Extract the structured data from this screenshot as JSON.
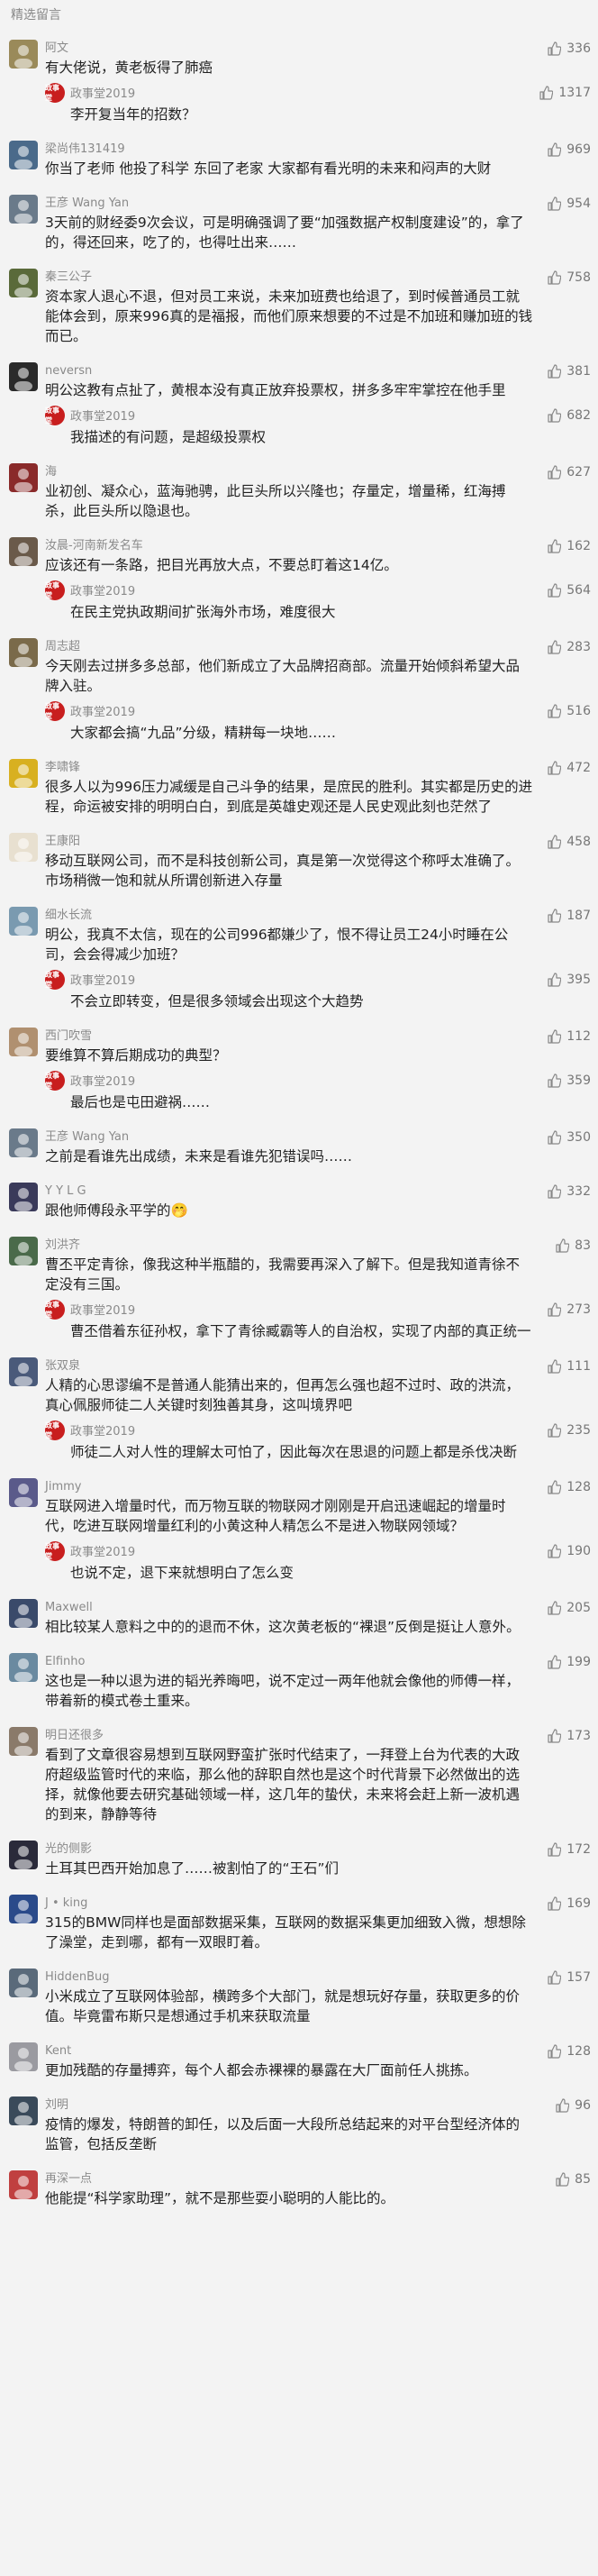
{
  "header": {
    "title": "精选留言"
  },
  "reply_author": "政事堂2019",
  "reply_logo_text": "政事堂",
  "comments": [
    {
      "name": "阿文",
      "likes": "336",
      "content": "有大佬说，黄老板得了肺癌",
      "reply": {
        "likes": "1317",
        "content": "李开复当年的招数？"
      },
      "avatar_color": "#9a8a5a"
    },
    {
      "name": "梁尚伟131419",
      "likes": "969",
      "content": "你当了老师 他投了科学 东回了老家 大家都有看光明的未来和闷声的大财",
      "avatar_color": "#4a6a8a"
    },
    {
      "name": "王彦 Wang Yan",
      "likes": "954",
      "content": "3天前的财经委9次会议，可是明确强调了要“加强数据产权制度建设”的，拿了的，得还回来，吃了的，也得吐出来……",
      "avatar_color": "#6a7a8a"
    },
    {
      "name": "秦三公子",
      "likes": "758",
      "content": "资本家人退心不退，但对员工来说，未来加班费也给退了，到时候普通员工就能体会到，原来996真的是福报，而他们原来想要的不过是不加班和赚加班的钱而已。",
      "avatar_color": "#5a6a3a"
    },
    {
      "name": "neversn",
      "likes": "381",
      "content": "明公这教有点扯了，黄根本没有真正放弃投票权，拼多多牢牢掌控在他手里",
      "reply": {
        "likes": "682",
        "content": "我描述的有问题，是超级投票权"
      },
      "avatar_color": "#2a2a2a"
    },
    {
      "name": "海",
      "likes": "627",
      "content": "业初创、凝众心，蓝海驰骋，此巨头所以兴隆也；存量定，增量稀，红海搏杀，此巨头所以隐退也。",
      "avatar_color": "#8a2a2a"
    },
    {
      "name": "汝晨-河南新发名车",
      "likes": "162",
      "content": "应该还有一条路，把目光再放大点，不要总盯着这14亿。",
      "reply": {
        "likes": "564",
        "content": "在民主党执政期间扩张海外市场，难度很大"
      },
      "avatar_color": "#6a5a4a"
    },
    {
      "name": "周志超",
      "likes": "283",
      "content": "今天刚去过拼多多总部，他们新成立了大品牌招商部。流量开始倾斜希望大品牌入驻。",
      "reply": {
        "likes": "516",
        "content": "大家都会搞“九品”分级，精耕每一块地……"
      },
      "avatar_color": "#7a6a4a"
    },
    {
      "name": "李啸锋",
      "likes": "472",
      "content": "很多人以为996压力减缓是自己斗争的结果，是庶民的胜利。其实都是历史的进程，命运被安排的明明白白，到底是英雄史观还是人民史观此刻也茫然了",
      "avatar_color": "#d8b020"
    },
    {
      "name": "王康阳",
      "likes": "458",
      "content": "移动互联网公司，而不是科技创新公司，真是第一次觉得这个称呼太准确了。市场稍微一饱和就从所谓创新进入存量",
      "avatar_color": "#e8e0d0"
    },
    {
      "name": "细水长流",
      "likes": "187",
      "content": "明公，我真不太信，现在的公司996都嫌少了，恨不得让员工24小时睡在公司，会会得减少加班？",
      "reply": {
        "likes": "395",
        "content": "不会立即转变，但是很多领域会出现这个大趋势"
      },
      "avatar_color": "#7a9ab0"
    },
    {
      "name": "西门吹雪",
      "likes": "112",
      "content": "要维算不算后期成功的典型？",
      "reply": {
        "likes": "359",
        "content": "最后也是屯田避祸……"
      },
      "avatar_color": "#b09070"
    },
    {
      "name": "王彦 Wang Yan",
      "likes": "350",
      "content": "之前是看谁先出成绩，未来是看谁先犯错误吗……",
      "avatar_color": "#6a7a8a"
    },
    {
      "name": "Y Y L G",
      "likes": "332",
      "content": "跟他师傅段永平学的🤭",
      "avatar_color": "#3a3a5a"
    },
    {
      "name": "刘洪齐",
      "likes": "83",
      "content": "曹丕平定青徐，像我这种半瓶醋的，我需要再深入了解下。但是我知道青徐不定没有三国。",
      "reply": {
        "likes": "273",
        "content": "曹丕借着东征孙权，拿下了青徐臧霸等人的自治权，实现了内部的真正统一"
      },
      "avatar_color": "#4a6a4a"
    },
    {
      "name": "张双泉",
      "likes": "111",
      "content": "人精的心思谬编不是普通人能猜出来的，但再怎么强也超不过时、政的洪流，真心佩服师徒二人关键时刻独善其身，这叫境界吧",
      "reply": {
        "likes": "235",
        "content": "师徒二人对人性的理解太可怕了，因此每次在思退的问题上都是杀伐决断"
      },
      "avatar_color": "#4a5a7a"
    },
    {
      "name": "Jimmy",
      "likes": "128",
      "content": "互联网进入增量时代，而万物互联的物联网才刚刚是开启迅速崛起的增量时代，吃进互联网增量红利的小黄这种人精怎么不是进入物联网领域？",
      "reply": {
        "likes": "190",
        "content": "也说不定，退下来就想明白了怎么变"
      },
      "avatar_color": "#5a5a8a"
    },
    {
      "name": "Maxwell",
      "likes": "205",
      "content": "相比较某人意料之中的的退而不休，这次黄老板的“裸退”反倒是挺让人意外。",
      "avatar_color": "#3a4a6a"
    },
    {
      "name": "Elfinho",
      "likes": "199",
      "content": "这也是一种以退为进的韬光养晦吧，说不定过一两年他就会像他的师傅一样，带着新的模式卷土重来。",
      "avatar_color": "#6a8aa0"
    },
    {
      "name": "明日还很多",
      "likes": "173",
      "content": "看到了文章很容易想到互联网野蛮扩张时代结束了，一拜登上台为代表的大政府超级监管时代的来临，那么他的辞职自然也是这个时代背景下必然做出的选择，就像他要去研究基础领域一样，这几年的蛰伏，未来将会赶上新一波机遇的到来，静静等待",
      "avatar_color": "#8a7a6a"
    },
    {
      "name": "光的侧影",
      "likes": "172",
      "content": "土耳其巴西开始加息了……被割怕了的“王石”们",
      "avatar_color": "#2a2a3a"
    },
    {
      "name": "J • king",
      "likes": "169",
      "content": "315的BMW同样也是面部数据采集，互联网的数据采集更加细致入微，想想除了澡堂，走到哪，都有一双眼盯着。",
      "avatar_color": "#2a4a8a"
    },
    {
      "name": "HiddenBug",
      "likes": "157",
      "content": "小米成立了互联网体验部，横跨多个大部门，就是想玩好存量，获取更多的价值。毕竟雷布斯只是想通过手机来获取流量",
      "avatar_color": "#5a6a7a"
    },
    {
      "name": "Kent",
      "likes": "128",
      "content": "更加残酷的存量搏弈，每个人都会赤裸裸的暴露在大厂面前任人挑拣。",
      "avatar_color": "#9a9aa0"
    },
    {
      "name": "刘明",
      "likes": "96",
      "content": "疫情的爆发，特朗普的卸任，以及后面一大段所总结起来的对平台型经济体的监管，包括反垄断",
      "avatar_color": "#3a4a5a"
    },
    {
      "name": "再深一点",
      "likes": "85",
      "content": "他能提“科学家助理”，就不是那些耍小聪明的人能比的。",
      "avatar_color": "#c04040"
    }
  ]
}
